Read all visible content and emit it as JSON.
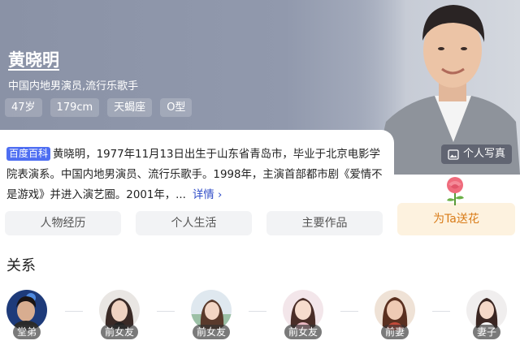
{
  "header": {
    "name": "黄晓明",
    "subtitle": "中国内地男演员,流行乐歌手",
    "tags": [
      "47岁",
      "179cm",
      "天蝎座",
      "O型"
    ],
    "photo_button": "个人写真"
  },
  "intro": {
    "badge": "百度百科",
    "text": "黄晓明，1977年11月13日出生于山东省青岛市，毕业于北京电影学院表演系。中国内地男演员、流行乐歌手。1998年，主演首部都市剧《爱情不是游戏》并进入演艺圈。2001年，...",
    "more": "详情"
  },
  "tabs": [
    "人物经历",
    "个人生活",
    "主要作品"
  ],
  "flower_button": "为Ta送花",
  "relations": {
    "title": "关系",
    "items": [
      {
        "label": "堂弟"
      },
      {
        "label": "前女友"
      },
      {
        "label": "前女友"
      },
      {
        "label": "前女友"
      },
      {
        "label": "前妻"
      },
      {
        "label": "妻子"
      }
    ]
  },
  "colors": {
    "accent": "#4e6ef2",
    "link": "#2e4bc7",
    "flower_bg": "#fdf2df",
    "flower_text": "#d97c18"
  }
}
